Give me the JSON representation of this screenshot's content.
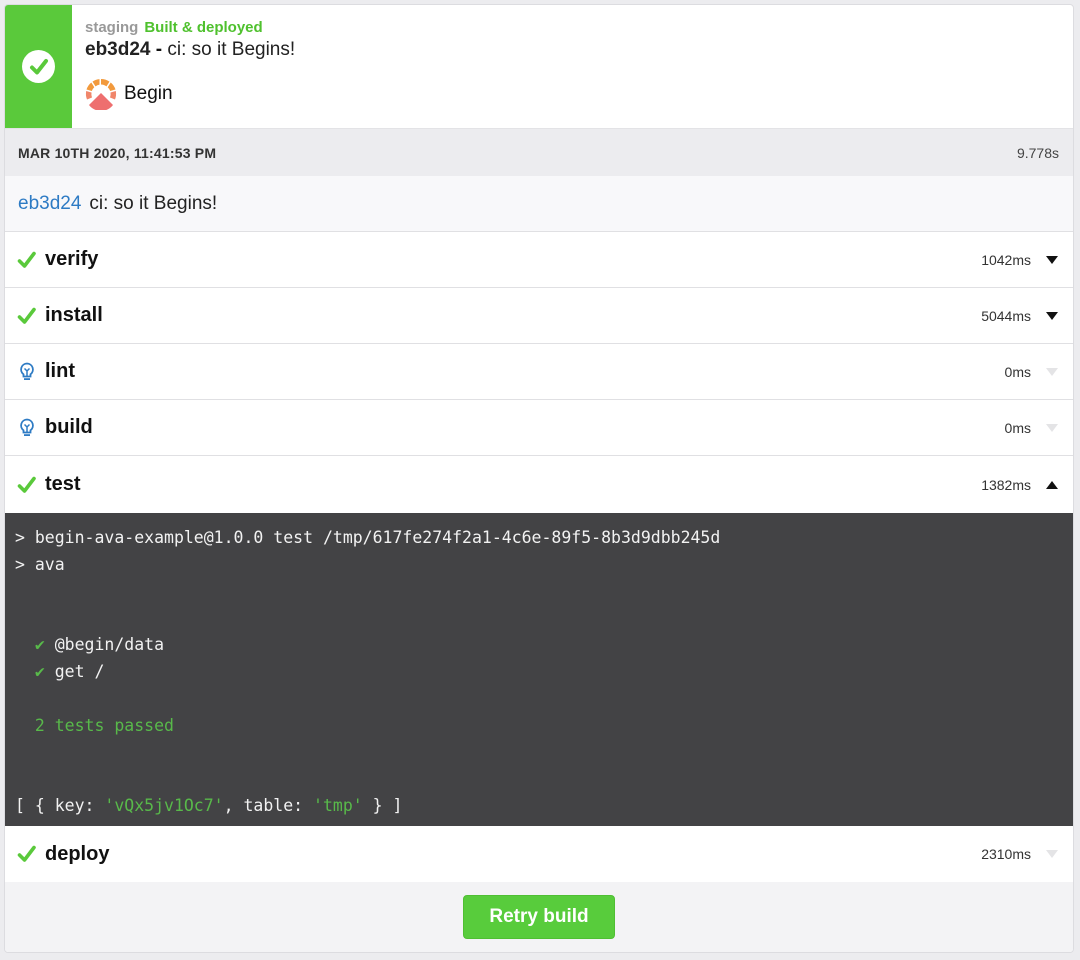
{
  "header": {
    "environment": "staging",
    "status": "Built & deployed",
    "commit_sha": "eb3d24",
    "separator": " - ",
    "commit_message": "ci: so it Begins!",
    "app_name": "Begin",
    "status_color": "#5ac93b"
  },
  "timebar": {
    "date": "MAR 10TH 2020, 11:41:53 PM",
    "duration": "9.778s"
  },
  "commit": {
    "sha": "eb3d24",
    "message": "ci: so it Begins!"
  },
  "steps": [
    {
      "name": "verify",
      "duration": "1042ms",
      "status": "success",
      "icon": "check-icon",
      "expanded": false
    },
    {
      "name": "install",
      "duration": "5044ms",
      "status": "success",
      "icon": "check-icon",
      "expanded": false
    },
    {
      "name": "lint",
      "duration": "0ms",
      "status": "skipped",
      "icon": "lightbulb-icon",
      "expanded": false
    },
    {
      "name": "build",
      "duration": "0ms",
      "status": "skipped",
      "icon": "lightbulb-icon",
      "expanded": false
    },
    {
      "name": "test",
      "duration": "1382ms",
      "status": "success",
      "icon": "check-icon",
      "expanded": true
    },
    {
      "name": "deploy",
      "duration": "2310ms",
      "status": "success",
      "icon": "check-icon",
      "expanded": false
    }
  ],
  "test_log": {
    "line1": "> begin-ava-example@1.0.0 test /tmp/617fe274f2a1-4c6e-89f5-8b3d9dbb245d",
    "line2": "> ava",
    "check_mark": "✔",
    "test1": "@begin/data",
    "test2": "get /",
    "summary": "2 tests passed",
    "output_prefix": "[ { key: ",
    "output_key": "'vQx5jv1Oc7'",
    "output_mid": ", table: ",
    "output_table": "'tmp'",
    "output_suffix": " } ]"
  },
  "footer": {
    "retry_label": "Retry build"
  }
}
